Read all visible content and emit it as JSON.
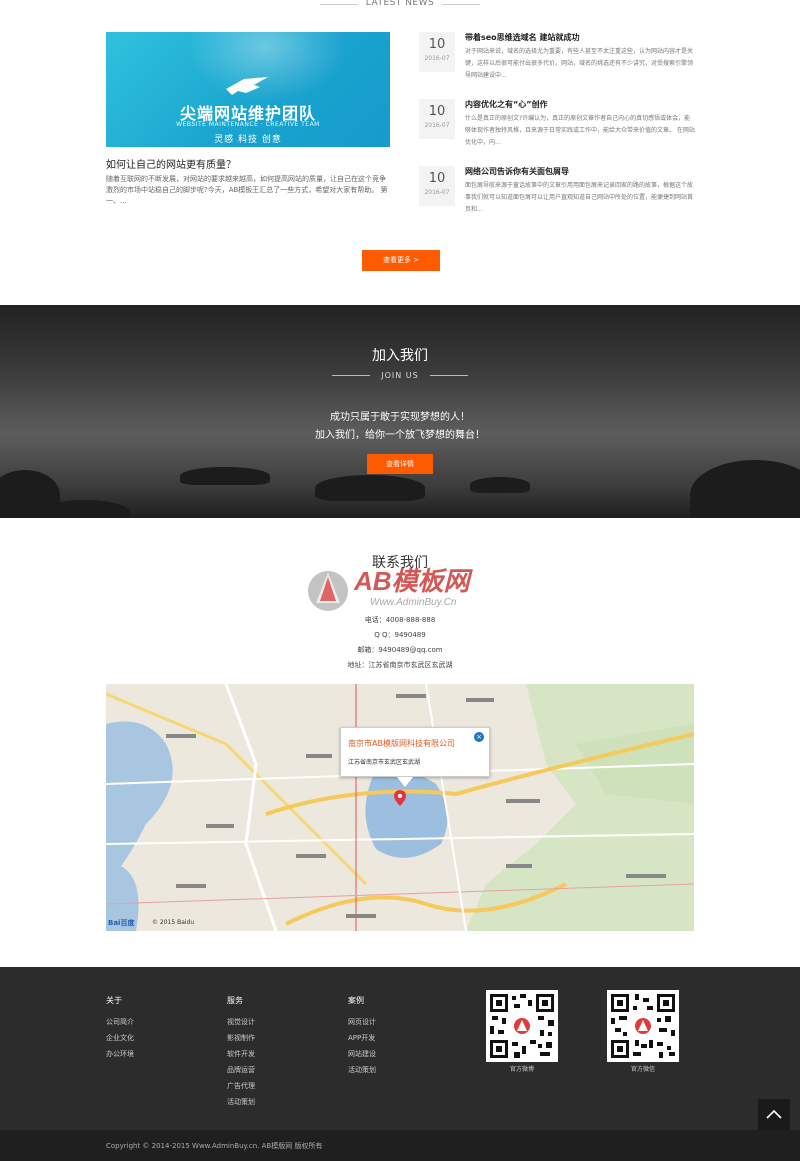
{
  "news": {
    "heading": "LATEST NEWS",
    "feature": {
      "image_title": "尖端网站维护团队",
      "image_subtitle": "WEBSITE MAINTENANCE · CREATIVE TEAM",
      "image_tags": "灵感 科技 创意",
      "title": "如何让自己的网站更有质量？",
      "desc": "随着互联网的不断发展，对网站的要求越来越高，如何提高网站的质量，让自己在这个竞争激烈的市场中站稳自己的脚步呢?今天，AB模板王汇总了一些方式，希望对大家有帮助。 第一、..."
    },
    "items": [
      {
        "day": "10",
        "ym": "2016-07",
        "title": "带着seo思维选域名 建站就成功",
        "desc": "对于网站来说，域名的选择尤为重要，有些人甚至不太注重这些，认为网站内容才是关键，这样以后很可能付出很多代价。网站，域名的挑选还有不少讲究，对受搜索引擎领导网站建设中..."
      },
      {
        "day": "10",
        "ym": "2016-07",
        "title": "内容优化之有“心”创作",
        "desc": "什么是真正的原创文?许编认为，真正的原创文章作者自己内心的真切感悟或体会，能够体现作者独特风格，且来源于日常实践或工作中，能给大众带来价值的文章。 在网站优化中，内..."
      },
      {
        "day": "10",
        "ym": "2016-07",
        "title": "网络公司告诉你有关面包屑导",
        "desc": "面包屑导航来源于童话故事中的文章引用用面包屑来记录回家的路的故事，根据这个故事我们就可以知道面包屑可以让用户直观知道自己网站中所处的位置，能便捷到网站首页和..."
      }
    ],
    "more_button": "查看更多 >"
  },
  "join": {
    "title": "加入我们",
    "subtitle": "JOIN US",
    "text1": "成功只属于敢于实现梦想的人！",
    "text2": "加入我们，给你一个放飞梦想的舞台！",
    "button": "查看详情"
  },
  "contact": {
    "title": "联系我们",
    "watermark_brand": "AB模板网",
    "watermark_url": "Www.AdminBuy.Cn",
    "phone": "电话：4008-888-888",
    "qq": "Q Q：9490489",
    "email": "邮箱：9490489@qq.com",
    "address": "地址：江苏省南京市玄武区玄武湖"
  },
  "map": {
    "popup_company": "南京市AB模版网科技有限公司",
    "popup_address": "江苏省南京市玄武区玄武湖",
    "popup_close": "×",
    "baidu_logo": "Bai百度",
    "baidu_copy": "© 2015 Baidu"
  },
  "footer": {
    "columns": [
      {
        "title": "关于",
        "items": [
          "公司简介",
          "企业文化",
          "办公环境"
        ]
      },
      {
        "title": "服务",
        "items": [
          "视觉设计",
          "影视制作",
          "软件开发",
          "品牌运营",
          "广告代理",
          "活动策划"
        ]
      },
      {
        "title": "案例",
        "items": [
          "网页设计",
          "APP开发",
          "网站建设",
          "活动策划"
        ]
      }
    ],
    "qr_codes": [
      {
        "label": "官方微博"
      },
      {
        "label": "官方微信"
      }
    ],
    "copyright": "Copyright © 2014-2015 Www.AdminBuy.cn. AB模版网 版权所有"
  },
  "icons": {
    "to_top": "chevron-up-icon",
    "map_marker": "map-marker-icon"
  },
  "colors": {
    "accent": "#ff5a00",
    "footer_bg": "#2c2c2c",
    "bottom_bar": "#1f1f1f"
  }
}
